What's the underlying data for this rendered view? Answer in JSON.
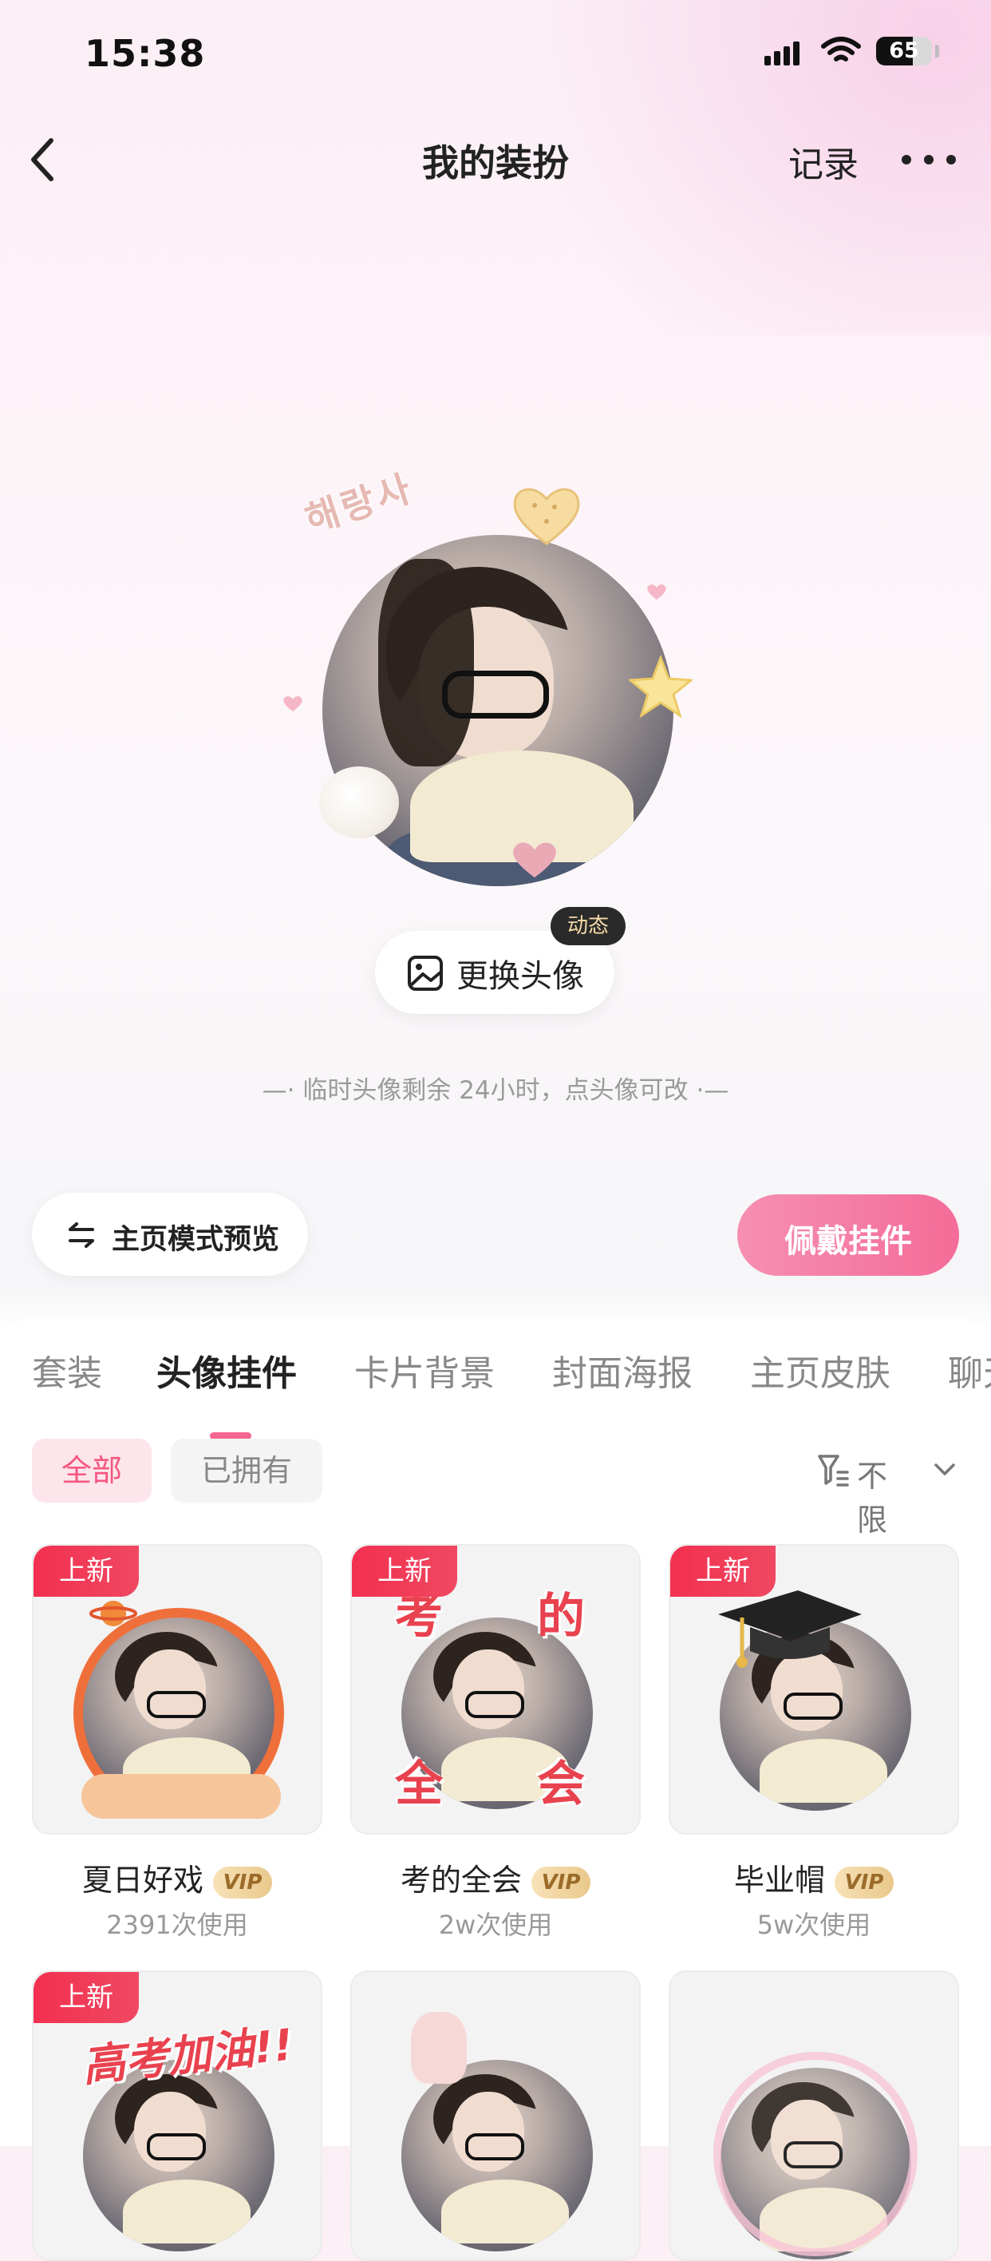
{
  "status_bar": {
    "time": "15:38",
    "battery": "65",
    "battery_level": 0.65
  },
  "nav": {
    "title": "我的装扮",
    "record": "记录"
  },
  "avatar": {
    "deco_text": "해랑사"
  },
  "change_avatar": {
    "label": "更换头像",
    "badge": "动态"
  },
  "hint": "—· 临时头像剩余 24小时，点头像可改 ·—",
  "preview": {
    "label": "主页模式预览"
  },
  "wear": {
    "label": "佩戴挂件"
  },
  "tabs": [
    "套装",
    "头像挂件",
    "卡片背景",
    "封面海报",
    "主页皮肤",
    "聊天"
  ],
  "chips": {
    "all": "全部",
    "owned": "已拥有"
  },
  "filter": {
    "label": "不限"
  },
  "items": [
    {
      "name": "夏日好戏",
      "vip": "VIP",
      "uses": "2391次使用",
      "tag": "上新"
    },
    {
      "name": "考的全会",
      "vip": "VIP",
      "uses": "2w次使用",
      "tag": "上新",
      "overlay": [
        "考",
        "的",
        "全",
        "会"
      ]
    },
    {
      "name": "毕业帽",
      "vip": "VIP",
      "uses": "5w次使用",
      "tag": "上新"
    },
    {
      "tag": "上新",
      "overlay": "高考加油!!"
    },
    {},
    {}
  ],
  "colors": {
    "accent": "#f4668f",
    "tag_red": "#f2304f",
    "wear_gradient_start": "#f58fb2",
    "wear_gradient_end": "#f46c98"
  }
}
